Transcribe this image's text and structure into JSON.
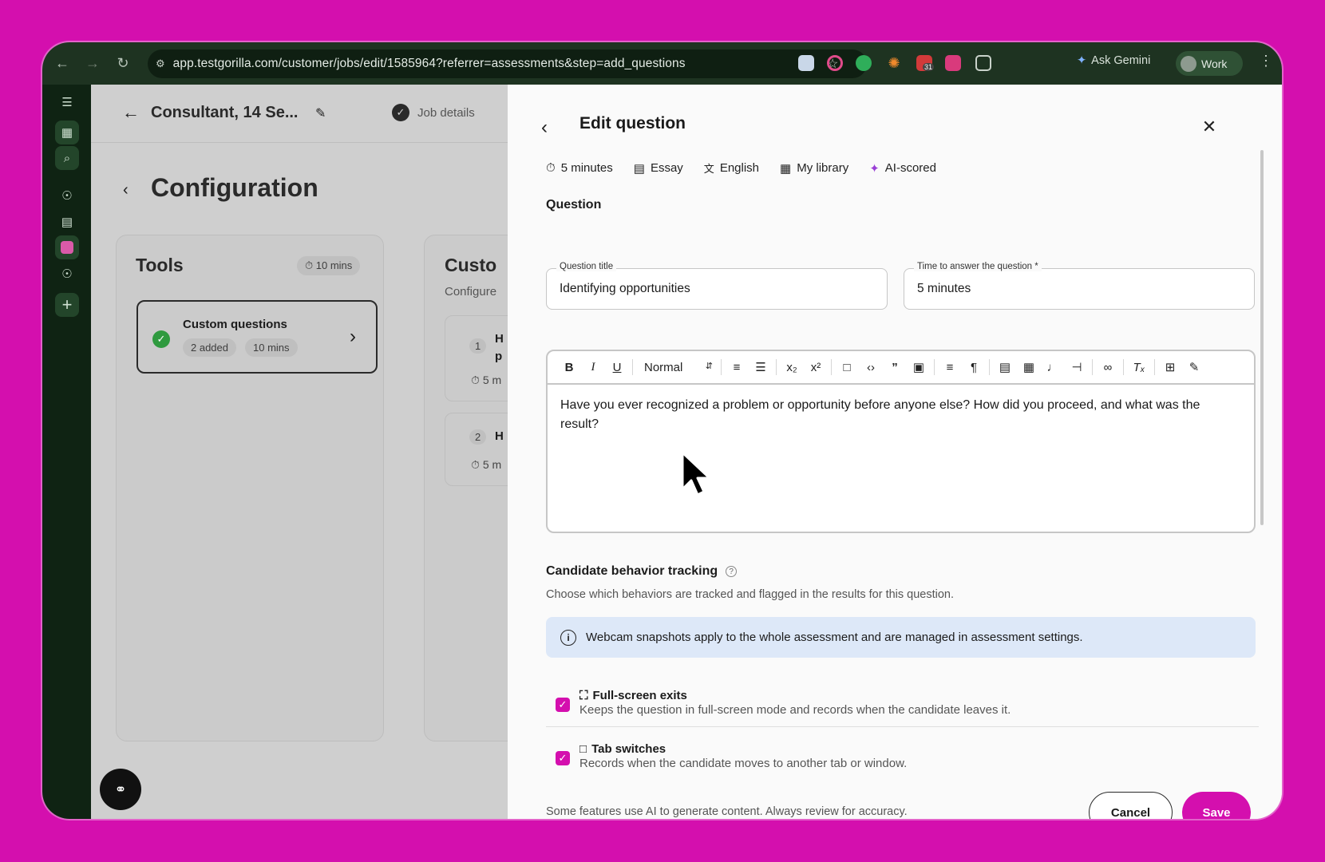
{
  "browser": {
    "url": "app.testgorilla.com/customer/jobs/edit/1585964?referrer=assessments&step=add_questions",
    "ask_gemini": "Ask Gemini",
    "profile": "Work",
    "ext_badge": "31"
  },
  "app": {
    "job_title": "Consultant, 14 Se...",
    "job_details": "Job details",
    "page_title": "Configuration",
    "tools": {
      "title": "Tools",
      "duration": "10 mins"
    },
    "custom_questions": {
      "title": "Custom questions",
      "added": "2 added",
      "duration": "10 mins"
    },
    "custom_panel": {
      "title_partial": "Custo",
      "subtitle_partial": "Configure",
      "q1_num": "1",
      "q1_text": "H",
      "q1_text2": "p",
      "q1_time": "5 m",
      "q2_num": "2",
      "q2_text": "H",
      "q2_time": "5 m"
    }
  },
  "edit_question": {
    "title": "Edit question",
    "meta": {
      "time": "5 minutes",
      "type": "Essay",
      "language": "English",
      "source": "My library",
      "scoring": "AI-scored"
    },
    "section_question": "Question",
    "question_title_label": "Question title",
    "question_title_value": "Identifying opportunities",
    "time_label": "Time to answer the question *",
    "time_value": "5 minutes",
    "format_select": "Normal",
    "question_body": "Have you ever recognized a problem or opportunity before anyone else? How did you proceed, and what was the result?",
    "tracking_title": "Candidate behavior tracking",
    "tracking_desc": "Choose which behaviors are tracked and flagged in the results for this question.",
    "info_banner": "Webcam snapshots apply to the whole assessment and are managed in assessment settings.",
    "options": [
      {
        "title": "Full-screen exits",
        "desc": "Keeps the question in full-screen mode and records when the candidate leaves it.",
        "checked": true
      },
      {
        "title": "Tab switches",
        "desc": "Records when the candidate moves to another tab or window.",
        "checked": true
      }
    ],
    "footer_note": "Some features use AI to generate content. Always review for accuracy.",
    "cancel_label": "Cancel",
    "save_label": "Save"
  },
  "colors": {
    "accent": "#d40fae",
    "rail": "#0f2313",
    "chrome": "#1e3321",
    "info_bg": "#dde8f8",
    "success": "#2f9a3f"
  }
}
